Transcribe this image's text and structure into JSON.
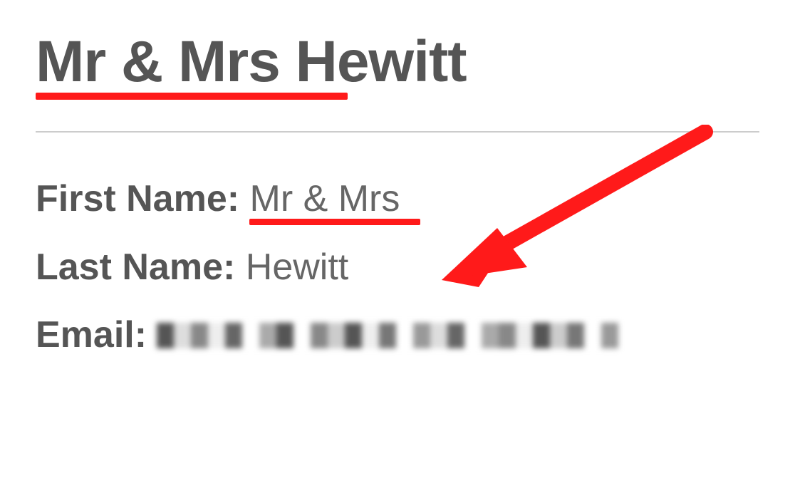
{
  "header": {
    "title": "Mr & Mrs Hewitt"
  },
  "fields": {
    "first_name_label": "First Name:",
    "first_name_value": "Mr & Mrs",
    "last_name_label": "Last Name:",
    "last_name_value": "Hewitt",
    "email_label": "Email:"
  },
  "annotations": {
    "underline_color": "#ff1a1a",
    "arrow_color": "#ff1a1a"
  }
}
